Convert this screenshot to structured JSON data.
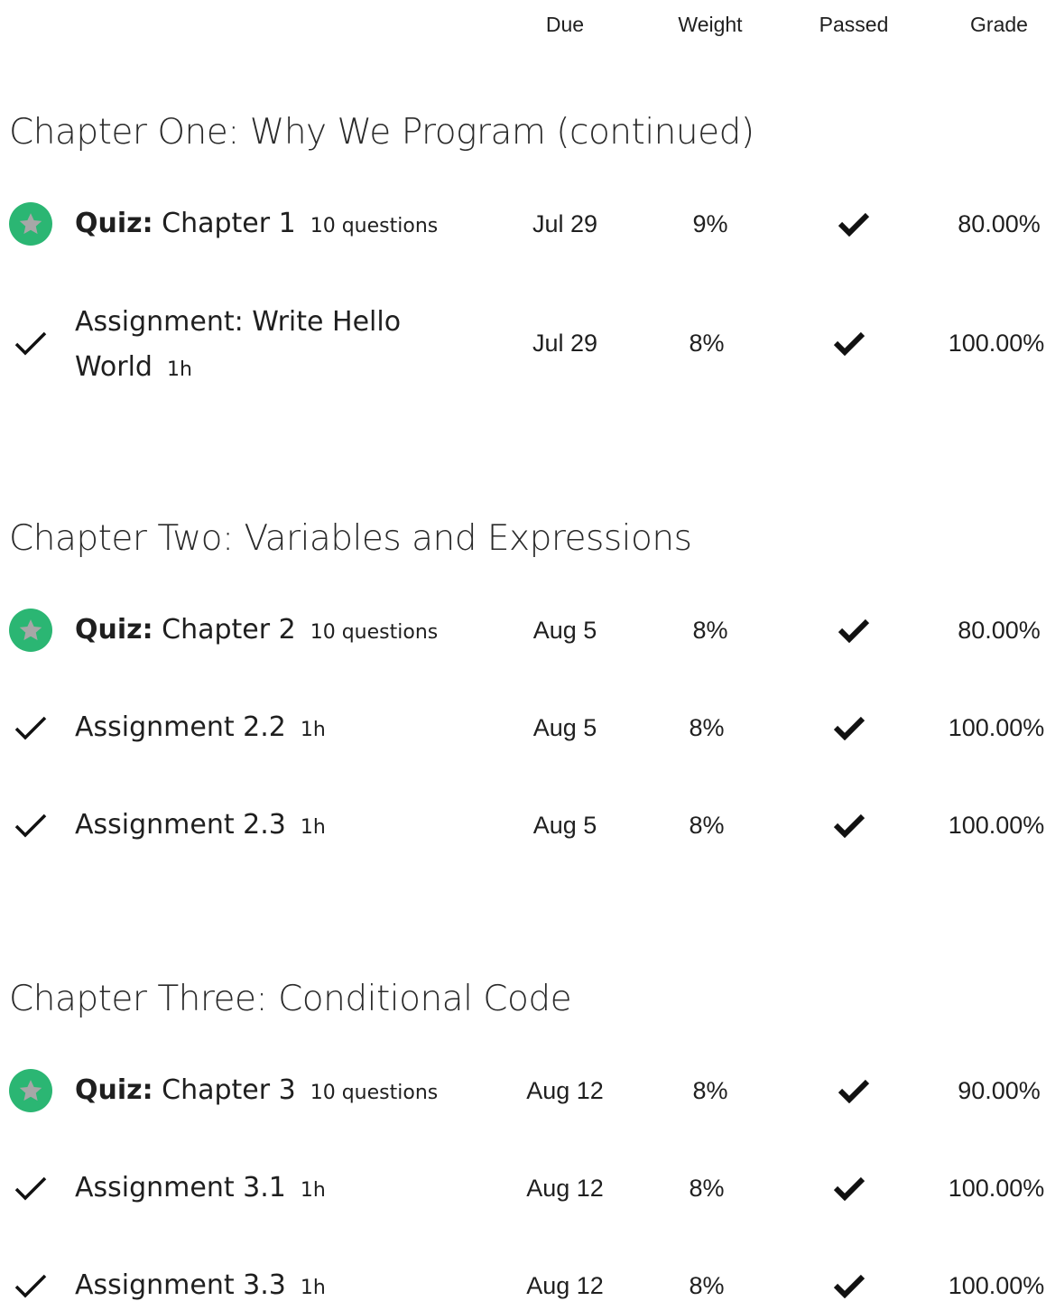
{
  "columns": {
    "due": "Due",
    "weight": "Weight",
    "passed": "Passed",
    "grade": "Grade"
  },
  "colors": {
    "quiz_badge": "#2bb673",
    "star": "#a7a7a7",
    "check": "#111111"
  },
  "chapters": [
    {
      "title": "Chapter One: Why We Program (continued)",
      "items": [
        {
          "type": "quiz",
          "lead": "Quiz:",
          "name": "Chapter 1",
          "meta": "10 questions",
          "due": "Jul 29",
          "weight": "9%",
          "grade": "80.00%",
          "icon": "star-icon"
        },
        {
          "type": "assignment",
          "lead": "",
          "name": "Assignment: Write Hello World",
          "meta": "1h",
          "due": "Jul 29",
          "weight": "8%",
          "grade": "100.00%",
          "icon": "checkmark-icon"
        }
      ]
    },
    {
      "title": "Chapter Two: Variables and Expressions",
      "items": [
        {
          "type": "quiz",
          "lead": "Quiz:",
          "name": "Chapter 2",
          "meta": "10 questions",
          "due": "Aug 5",
          "weight": "8%",
          "grade": "80.00%",
          "icon": "star-icon"
        },
        {
          "type": "assignment",
          "lead": "",
          "name": "Assignment 2.2",
          "meta": "1h",
          "due": "Aug 5",
          "weight": "8%",
          "grade": "100.00%",
          "icon": "checkmark-icon"
        },
        {
          "type": "assignment",
          "lead": "",
          "name": "Assignment 2.3",
          "meta": "1h",
          "due": "Aug 5",
          "weight": "8%",
          "grade": "100.00%",
          "icon": "checkmark-icon"
        }
      ]
    },
    {
      "title": "Chapter Three: Conditional Code",
      "items": [
        {
          "type": "quiz",
          "lead": "Quiz:",
          "name": "Chapter 3",
          "meta": "10 questions",
          "due": "Aug 12",
          "weight": "8%",
          "grade": "90.00%",
          "icon": "star-icon"
        },
        {
          "type": "assignment",
          "lead": "",
          "name": "Assignment 3.1",
          "meta": "1h",
          "due": "Aug 12",
          "weight": "8%",
          "grade": "100.00%",
          "icon": "checkmark-icon"
        },
        {
          "type": "assignment",
          "lead": "",
          "name": "Assignment 3.3",
          "meta": "1h",
          "due": "Aug 12",
          "weight": "8%",
          "grade": "100.00%",
          "icon": "checkmark-icon"
        }
      ]
    }
  ]
}
